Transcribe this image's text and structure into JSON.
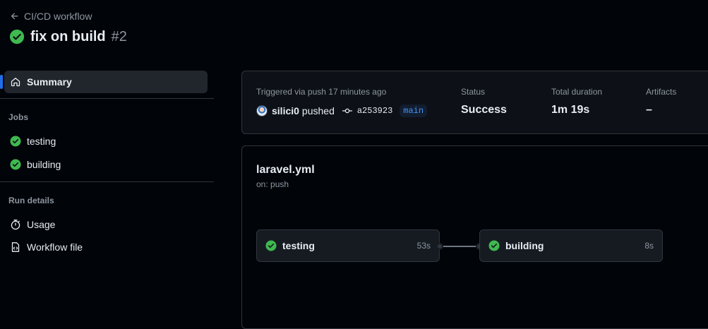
{
  "header": {
    "back_label": "CI/CD workflow",
    "run_title": "fix on build",
    "run_number": "#2"
  },
  "sidebar": {
    "summary_label": "Summary",
    "jobs_heading": "Jobs",
    "jobs": [
      {
        "label": "testing",
        "status": "success"
      },
      {
        "label": "building",
        "status": "success"
      }
    ],
    "run_details_heading": "Run details",
    "details": [
      {
        "label": "Usage",
        "icon": "stopwatch-icon"
      },
      {
        "label": "Workflow file",
        "icon": "file-code-icon"
      }
    ]
  },
  "summary": {
    "trigger_text": "Triggered via push 17 minutes ago",
    "actor": "silici0",
    "action": "pushed",
    "commit_sha": "a253923",
    "branch": "main",
    "status_label": "Status",
    "status_value": "Success",
    "duration_label": "Total duration",
    "duration_value": "1m 19s",
    "artifacts_label": "Artifacts",
    "artifacts_value": "–"
  },
  "workflow_graph": {
    "file_name": "laravel.yml",
    "trigger": "on: push",
    "jobs": [
      {
        "name": "testing",
        "duration": "53s",
        "status": "success"
      },
      {
        "name": "building",
        "duration": "8s",
        "status": "success"
      }
    ]
  },
  "colors": {
    "success": "#3fb950",
    "accent": "#1f6feb",
    "background": "#010409",
    "card": "#0d1117",
    "border": "#30363d",
    "muted_text": "#8d96a0",
    "branch_text": "#4493f8"
  }
}
